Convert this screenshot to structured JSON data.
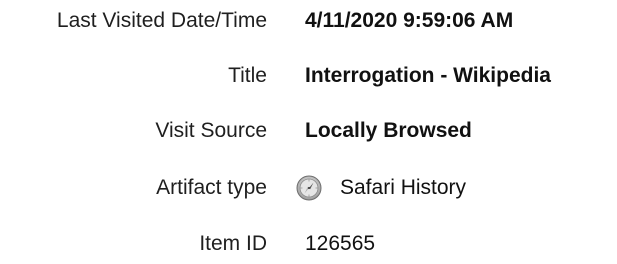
{
  "properties": [
    {
      "label": "Last Visited Date/Time",
      "value": "4/11/2020 9:59:06 AM"
    },
    {
      "label": "Title",
      "value": "Interrogation - Wikipedia"
    },
    {
      "label": "Visit Source",
      "value": "Locally Browsed"
    },
    {
      "label": "Artifact type",
      "value": "Safari History",
      "icon": "safari-compass-icon"
    },
    {
      "label": "Item ID",
      "value": "126565"
    }
  ]
}
